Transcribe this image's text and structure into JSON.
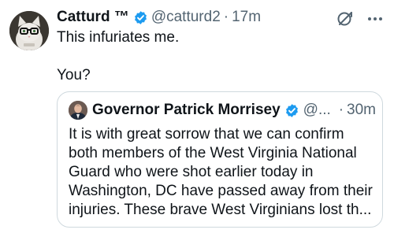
{
  "tweet": {
    "author": {
      "display_name": "Catturd ™",
      "handle": "@catturd2",
      "verified": true,
      "avatar": "cat-with-glasses-avatar"
    },
    "separator": "·",
    "time": "17m",
    "text_lines": [
      "This infuriates me.",
      "You?"
    ],
    "icons": {
      "grok": "grok-icon",
      "more": "more-options-icon"
    }
  },
  "quote": {
    "author": {
      "display_name": "Governor Patrick Morrisey",
      "handle": "@...",
      "verified": true,
      "avatar": "man-in-suit-avatar"
    },
    "separator": "·",
    "time": "30m",
    "text_lines": [
      "It is with great sorrow that we can confirm",
      "both members of the West Virginia National",
      "Guard who were shot earlier today in",
      "Washington, DC have passed away from their",
      "injuries. These brave West Virginians lost th..."
    ]
  },
  "colors": {
    "text": "#0f1419",
    "secondary": "#536471",
    "verified": "#1d9bf0",
    "border": "#cfd9de"
  }
}
